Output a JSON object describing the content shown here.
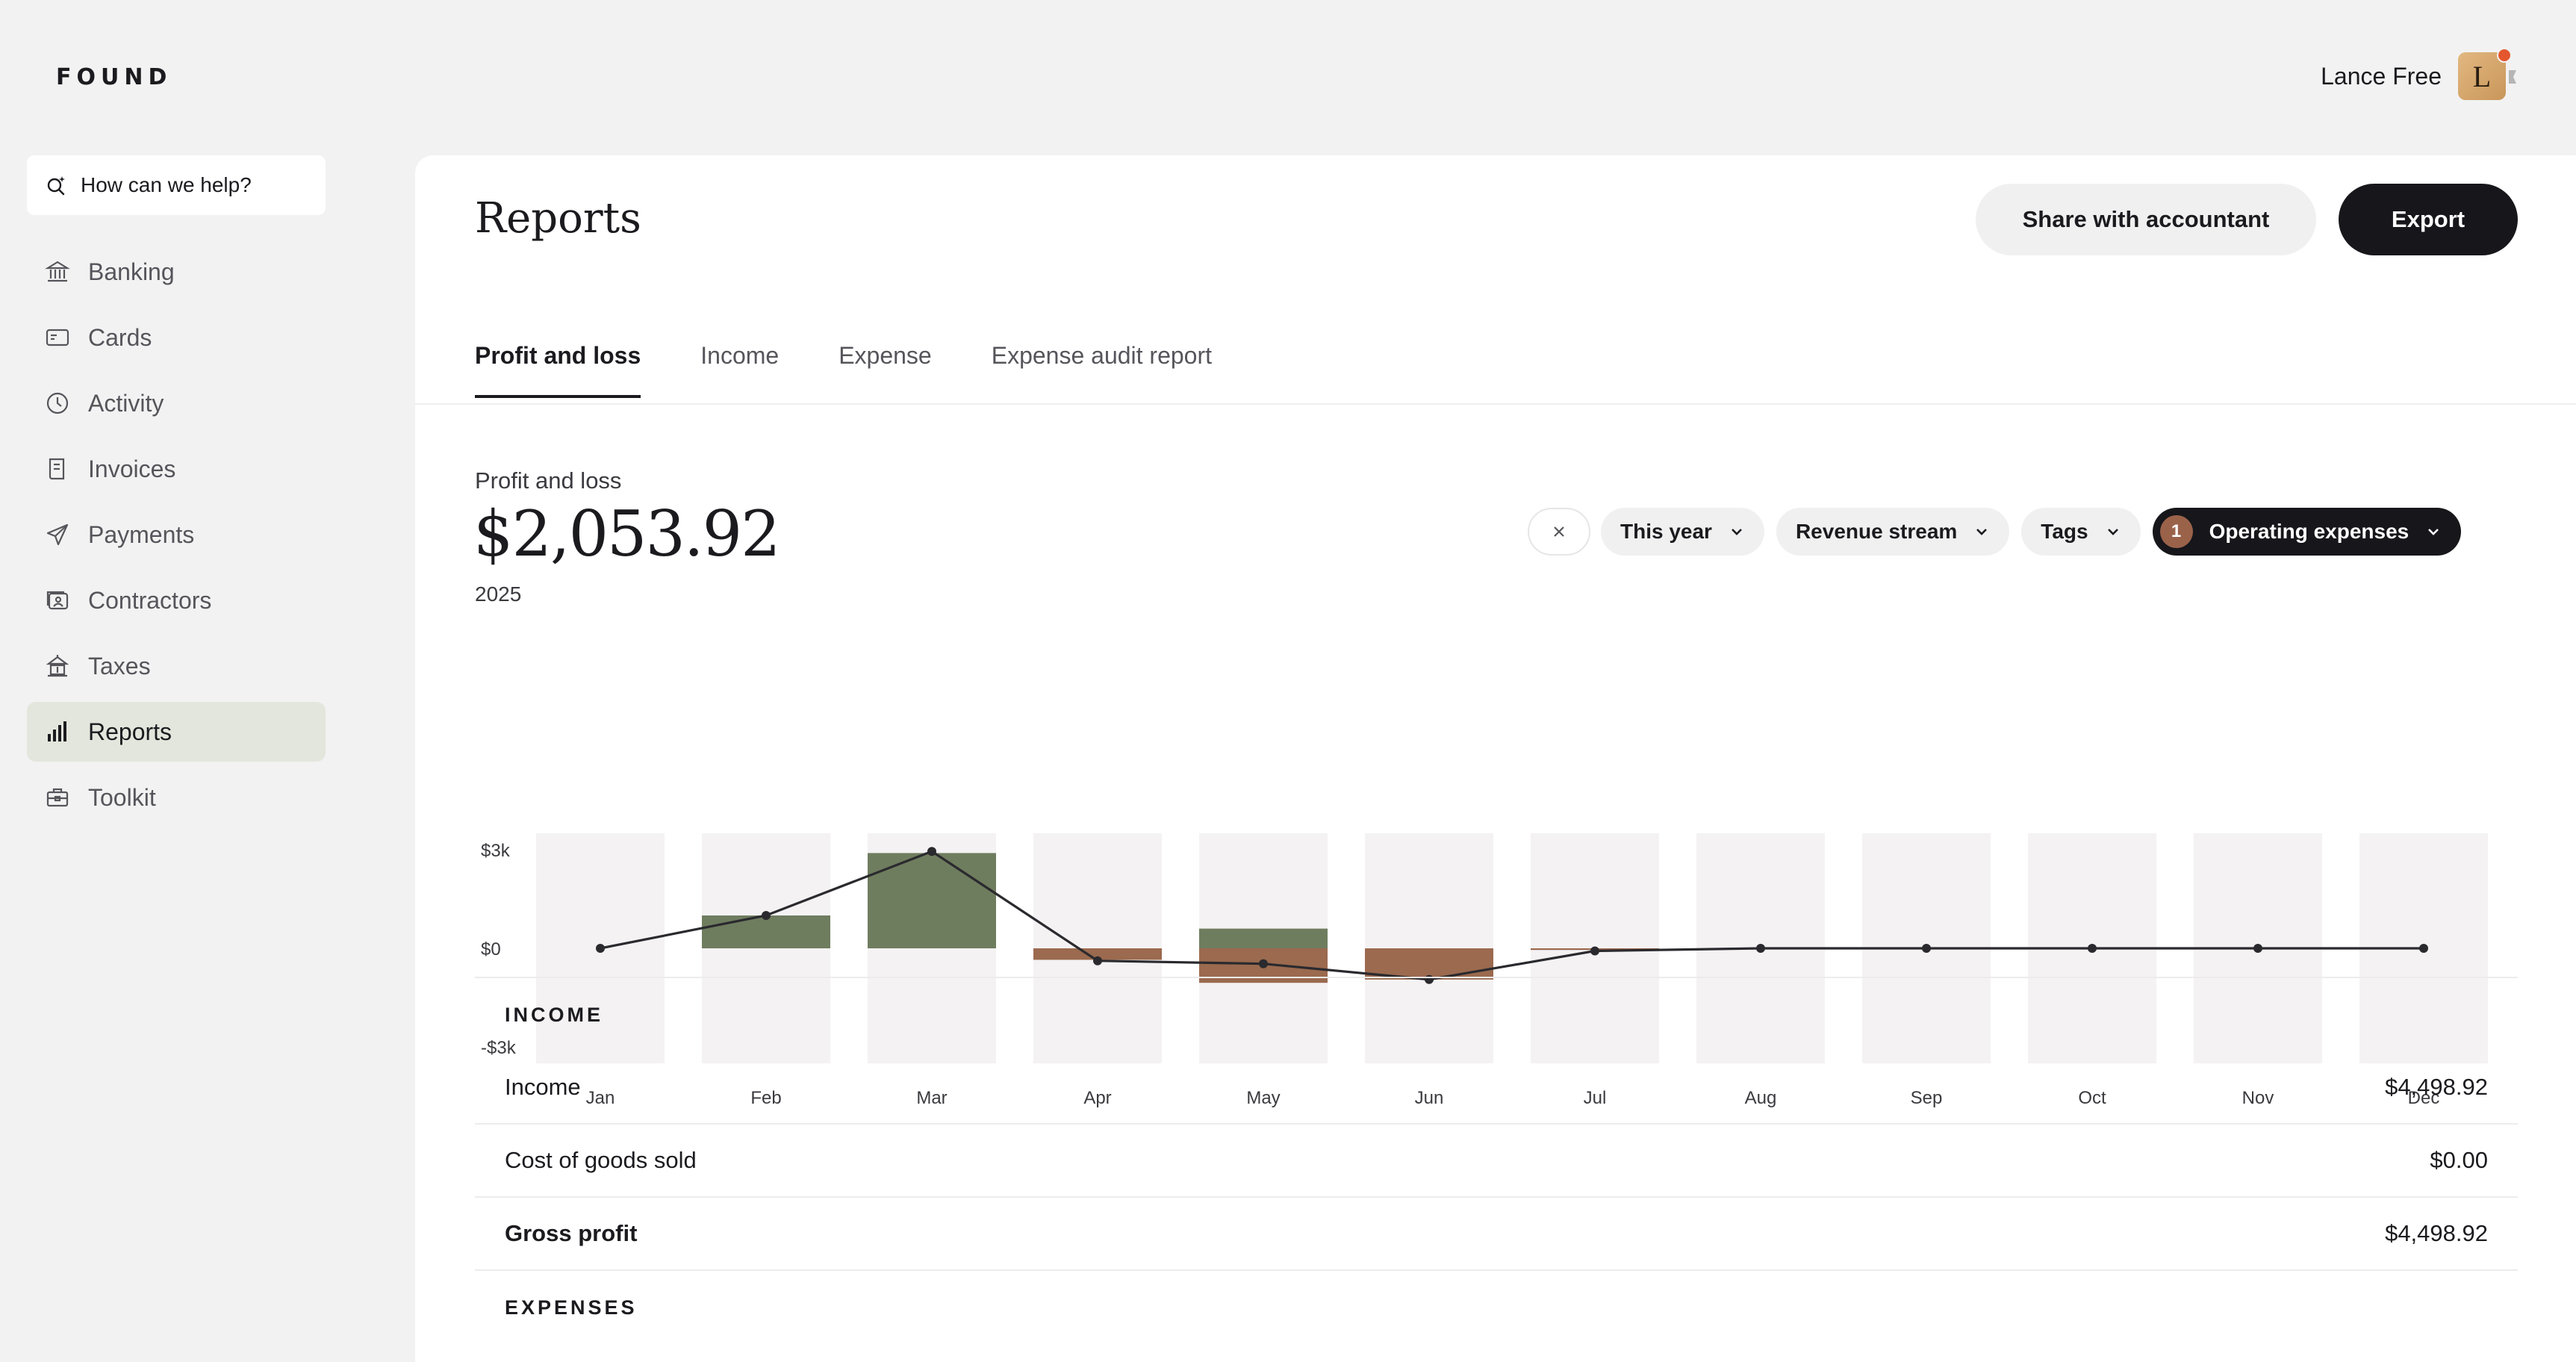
{
  "brand": "FOUND",
  "user": {
    "name": "Lance Free",
    "initial": "L"
  },
  "search": {
    "label": "How can we help?"
  },
  "sidebar": {
    "items": [
      {
        "label": "Banking",
        "icon": "bank-icon"
      },
      {
        "label": "Cards",
        "icon": "card-icon"
      },
      {
        "label": "Activity",
        "icon": "clock-icon"
      },
      {
        "label": "Invoices",
        "icon": "invoice-icon"
      },
      {
        "label": "Payments",
        "icon": "send-icon"
      },
      {
        "label": "Contractors",
        "icon": "contractor-icon"
      },
      {
        "label": "Taxes",
        "icon": "taxes-icon"
      },
      {
        "label": "Reports",
        "icon": "bar-chart-icon",
        "active": true
      },
      {
        "label": "Toolkit",
        "icon": "toolkit-icon"
      }
    ]
  },
  "header": {
    "title": "Reports",
    "share_label": "Share with accountant",
    "export_label": "Export"
  },
  "tabs": [
    {
      "label": "Profit and loss",
      "active": true
    },
    {
      "label": "Income"
    },
    {
      "label": "Expense"
    },
    {
      "label": "Expense audit report"
    }
  ],
  "summary": {
    "label": "Profit and loss",
    "amount": "$2,053.92",
    "year": "2025"
  },
  "filters": {
    "period": "This year",
    "revenue": "Revenue stream",
    "tags": "Tags",
    "operating_count": "1",
    "operating": "Operating expenses"
  },
  "chart_data": {
    "type": "bar",
    "categories": [
      "Jan",
      "Feb",
      "Mar",
      "Apr",
      "May",
      "Jun",
      "Jul",
      "Aug",
      "Sep",
      "Oct",
      "Nov",
      "Dec"
    ],
    "series": [
      {
        "values": [
          0,
          1000,
          2900,
          0,
          600,
          0,
          0,
          0,
          0,
          0,
          0,
          0
        ]
      },
      {
        "values": [
          0,
          0,
          0,
          -350,
          -1050,
          -950,
          -50,
          0,
          0,
          0,
          0,
          0
        ]
      }
    ],
    "line_values": [
      0,
      1000,
      2950,
      -380,
      -470,
      -950,
      -80,
      0,
      0,
      0,
      0,
      0
    ],
    "ylim": [
      -3500,
      3500
    ],
    "yticks": [
      {
        "value": 3000,
        "label": "$3k"
      },
      {
        "value": 0,
        "label": "$0"
      },
      {
        "value": -3000,
        "label": "-$3k"
      }
    ],
    "colors": {
      "income": "#6f7d5f",
      "expense": "#9b6a4f",
      "line": "#2a2a2e",
      "bg": "#f4f2f3"
    }
  },
  "table": {
    "income_title": "INCOME",
    "rows": [
      {
        "label": "Income",
        "value": "$4,498.92"
      },
      {
        "label": "Cost of goods sold",
        "value": "$0.00"
      },
      {
        "label": "Gross profit",
        "value": "$4,498.92",
        "bold": true
      }
    ],
    "expenses_title": "EXPENSES"
  }
}
